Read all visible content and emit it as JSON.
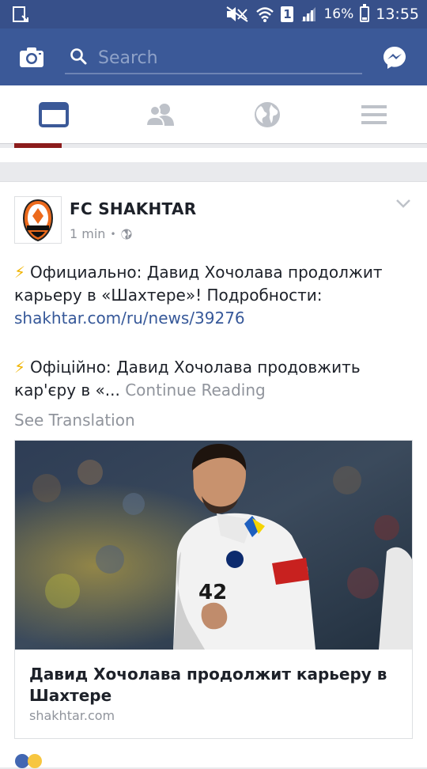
{
  "status_bar": {
    "sim_label": "1",
    "battery_percent": "16%",
    "time": "13:55"
  },
  "header": {
    "search_placeholder": "Search"
  },
  "tabs": [
    {
      "name": "news-feed",
      "icon": "news-feed-icon",
      "active": true
    },
    {
      "name": "friends",
      "icon": "friends-icon",
      "active": false
    },
    {
      "name": "notifications",
      "icon": "globe-icon",
      "active": false
    },
    {
      "name": "menu",
      "icon": "menu-icon",
      "active": false
    }
  ],
  "post": {
    "page_name": "FC SHAKHTAR",
    "time": "1 min",
    "separator": "•",
    "para1_text": "Официально: Давид Хочолава продолжит карьеру в «Шахтере»! Подробности: ",
    "para1_link": "shakhtar.com/ru/news/39276",
    "para2_text": "Офіційно: Давид Хочолава продовжить кар'єру в «... ",
    "continue_label": "Continue Reading",
    "translate_label": "See Translation",
    "link_preview": {
      "title": "Давид Хочолава продолжит карьеру в Шахтере",
      "domain": "shakhtar.com"
    }
  },
  "colors": {
    "brand_blue": "#3b5998",
    "status_bar": "#37508a",
    "link": "#365899",
    "muted": "#90949c",
    "active_tab": "#3b5998",
    "inactive_tab": "#bec2c9"
  }
}
